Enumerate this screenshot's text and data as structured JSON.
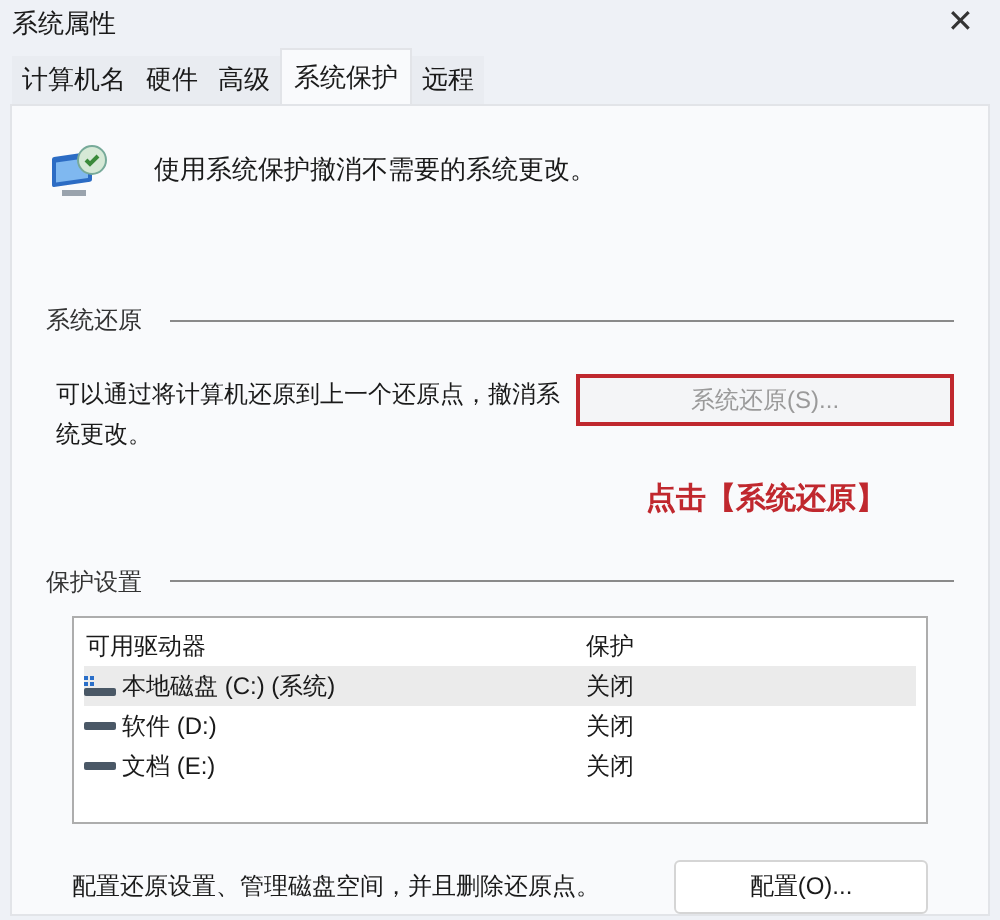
{
  "window": {
    "title": "系统属性",
    "close": "✕"
  },
  "tabs": [
    {
      "label": "计算机名",
      "selected": false
    },
    {
      "label": "硬件",
      "selected": false
    },
    {
      "label": "高级",
      "selected": false
    },
    {
      "label": "系统保护",
      "selected": true
    },
    {
      "label": "远程",
      "selected": false
    }
  ],
  "intro": "使用系统保护撤消不需要的系统更改。",
  "restore_group": {
    "title": "系统还原",
    "description": "可以通过将计算机还原到上一个还原点，撤消系统更改。",
    "button": {
      "label": "系统还原(S)...",
      "disabled": true,
      "highlighted": true
    },
    "annotation": "点击【系统还原】"
  },
  "protection_group": {
    "title": "保护设置",
    "columns": [
      "可用驱动器",
      "保护"
    ],
    "rows": [
      {
        "kind": "system",
        "drive": "本地磁盘 (C:) (系统)",
        "protection": "关闭",
        "selected": true
      },
      {
        "kind": "drive",
        "drive": "软件 (D:)",
        "protection": "关闭",
        "selected": false
      },
      {
        "kind": "drive",
        "drive": "文档 (E:)",
        "protection": "关闭",
        "selected": false
      }
    ],
    "description": "配置还原设置、管理磁盘空间，并且删除还原点。",
    "button": {
      "label": "配置(O)...",
      "disabled": false
    }
  }
}
